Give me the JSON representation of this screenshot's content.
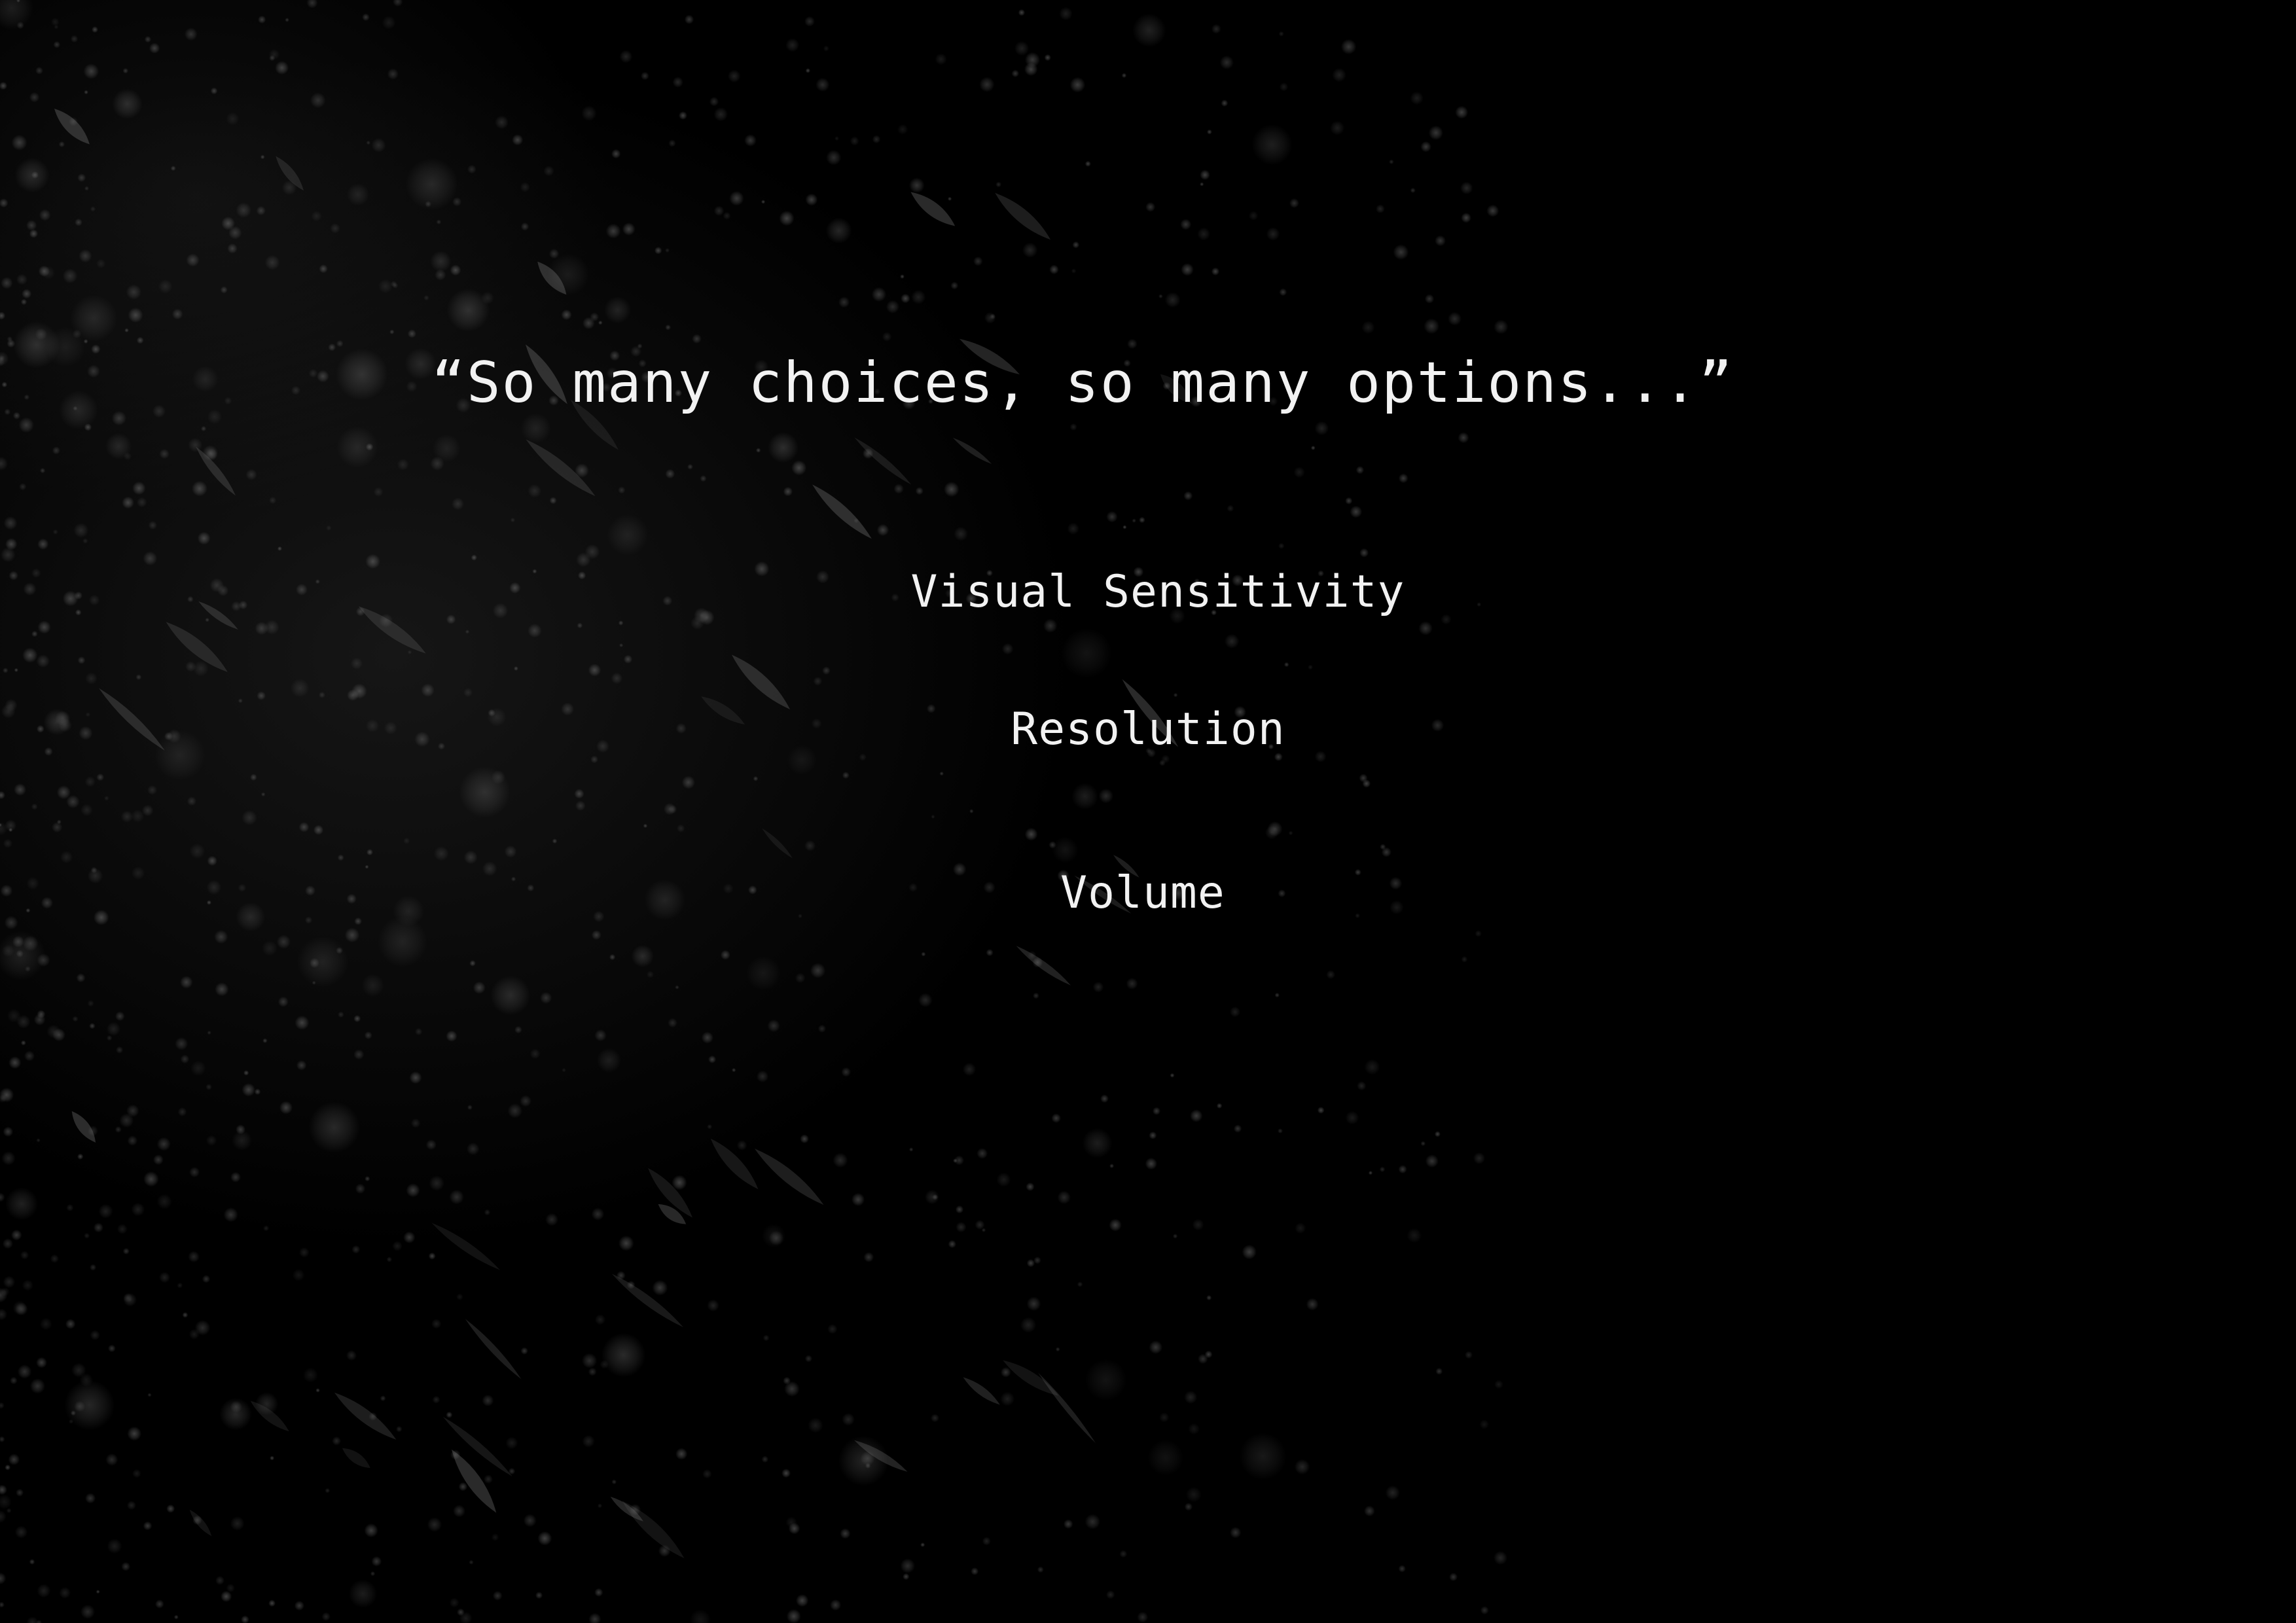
{
  "screen": {
    "quote": "“So many choices, so many options...”",
    "menu_items": [
      {
        "label": "Visual Sensitivity"
      },
      {
        "label": "Resolution"
      },
      {
        "label": "Volume"
      }
    ]
  },
  "colors": {
    "background": "#000000",
    "text": "#f2f2f2",
    "particles": "#8a8a8a"
  }
}
